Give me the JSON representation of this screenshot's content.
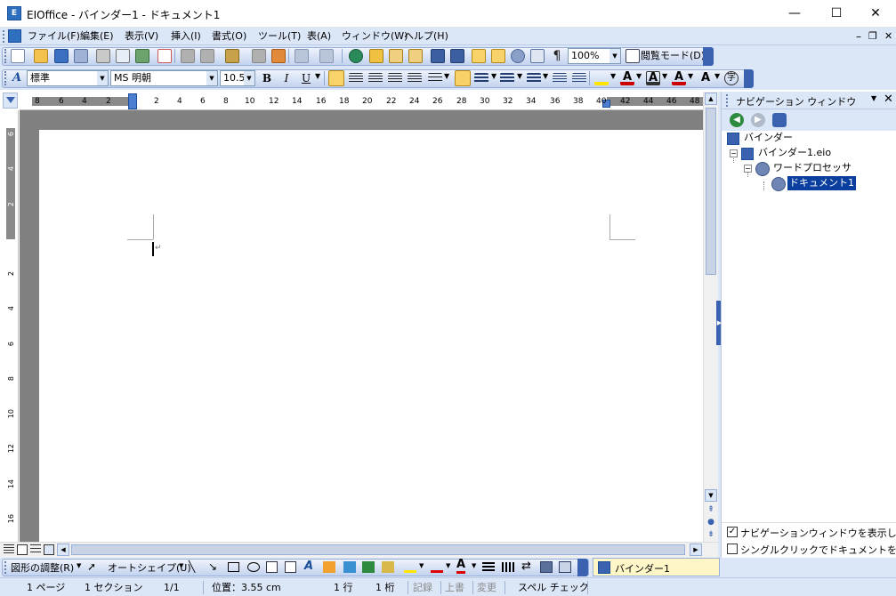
{
  "window": {
    "title": "EIOffice - バインダー1 - ドキュメント1",
    "app_icon": "eioffice-icon",
    "minimize_glyph": "—",
    "maximize_glyph": "☐",
    "close_glyph": "✕",
    "doc_minimize_glyph": "–",
    "doc_restore_glyph": "❐",
    "doc_close_glyph": "✕"
  },
  "menubar": {
    "items": [
      "ファイル(F)",
      "編集(E)",
      "表示(V)",
      "挿入(I)",
      "書式(O)",
      "ツール(T)",
      "表(A)",
      "ウィンドウ(W)",
      "ヘルプ(H)"
    ]
  },
  "standard_toolbar": {
    "zoom": "100%",
    "reading_mode": "閲覧モード(D)"
  },
  "format_toolbar": {
    "style": "標準",
    "font": "MS 明朝",
    "size": "10.5",
    "bold": "B",
    "italic": "I",
    "underline": "U"
  },
  "ruler": {
    "h_labels": [
      "8",
      "6",
      "4",
      "2",
      "2",
      "4",
      "6",
      "8",
      "10",
      "12",
      "14",
      "16",
      "18",
      "20",
      "22",
      "24",
      "26",
      "28",
      "30",
      "32",
      "34",
      "36",
      "38",
      "40",
      "42",
      "44",
      "46",
      "48"
    ],
    "v_labels": [
      "6",
      "4",
      "2",
      "2",
      "4",
      "6",
      "8",
      "10",
      "12",
      "14",
      "16"
    ]
  },
  "navigation": {
    "title": "ナビゲーション ウィンドウ",
    "tree": {
      "root": "バインダー",
      "binder": "バインダー1.eio",
      "word_processor": "ワードプロセッサ",
      "document": "ドキュメント1"
    },
    "options": [
      {
        "label": "ナビゲーションウィンドウを表示し続ける",
        "checked": true
      },
      {
        "label": "シングルクリックでドキュメントを開く",
        "checked": false
      }
    ]
  },
  "drawing_toolbar": {
    "adjust": "図形の調整(R)",
    "autoshape": "オートシェイプ(U)"
  },
  "taskbar": {
    "binder_tab": "バインダー1"
  },
  "status": {
    "page": "1 ページ",
    "section": "1 セクション",
    "page_of": "1/1",
    "position": "位置：3.55 cm",
    "line": "1 行",
    "column": "1 桁",
    "record": "記録",
    "overwrite": "上書",
    "change": "変更",
    "spell": "スペル チェック"
  },
  "colors": {
    "toolbar_bg": "#dbe6f7",
    "selection": "#0a3fa0",
    "doc_gray": "#808080"
  }
}
